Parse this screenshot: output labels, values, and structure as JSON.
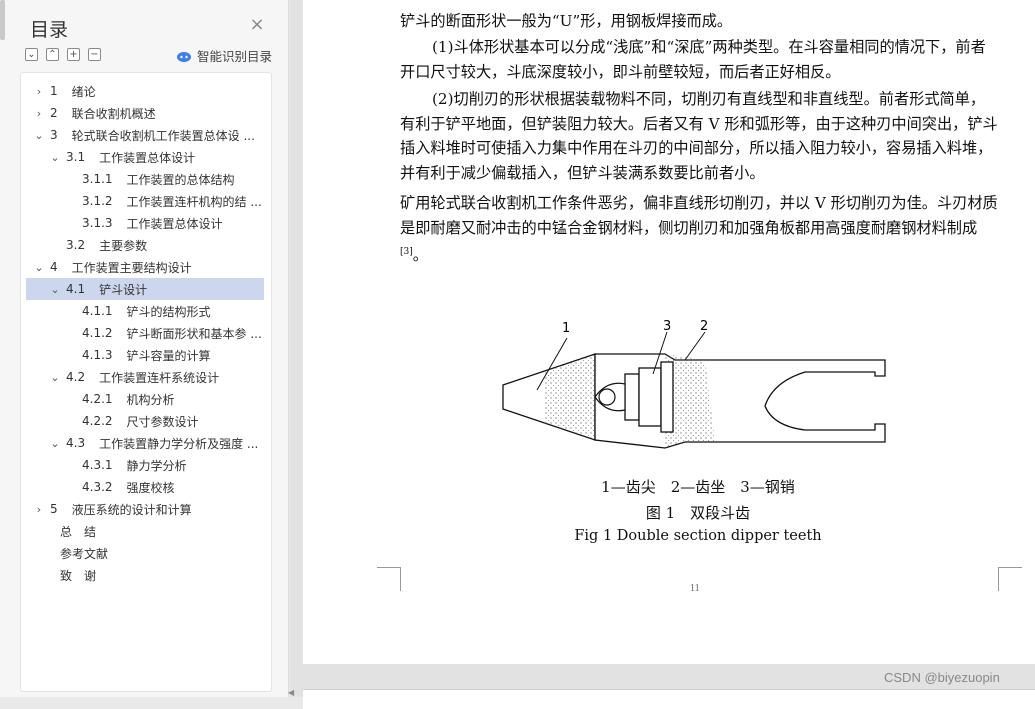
{
  "sidebar": {
    "title": "目录",
    "smart_label": "智能识别目录",
    "toc": [
      {
        "num": "1",
        "text": "绪论",
        "level": 1,
        "toggle": ">",
        "selected": false
      },
      {
        "num": "2",
        "text": "联合收割机概述",
        "level": 1,
        "toggle": ">",
        "selected": false
      },
      {
        "num": "3",
        "text": "轮式联合收割机工作装置总体设 ...",
        "level": 1,
        "toggle": "v",
        "selected": false
      },
      {
        "num": "3.1",
        "text": "工作装置总体设计",
        "level": 2,
        "toggle": "v",
        "selected": false
      },
      {
        "num": "3.1.1",
        "text": "工作装置的总体结构",
        "level": 3,
        "toggle": "",
        "selected": false
      },
      {
        "num": "3.1.2",
        "text": "工作装置连杆机构的结 ...",
        "level": 3,
        "toggle": "",
        "selected": false
      },
      {
        "num": "3.1.3",
        "text": "工作装置总体设计",
        "level": 3,
        "toggle": "",
        "selected": false
      },
      {
        "num": "3.2",
        "text": "主要参数",
        "level": 2,
        "toggle": "",
        "selected": false
      },
      {
        "num": "4",
        "text": "工作装置主要结构设计",
        "level": 1,
        "toggle": "v",
        "selected": false
      },
      {
        "num": "4.1",
        "text": "铲斗设计",
        "level": 2,
        "toggle": "v",
        "selected": true
      },
      {
        "num": "4.1.1",
        "text": "铲斗的结构形式",
        "level": 3,
        "toggle": "",
        "selected": false
      },
      {
        "num": "4.1.2",
        "text": "铲斗断面形状和基本参 ...",
        "level": 3,
        "toggle": "",
        "selected": false
      },
      {
        "num": "4.1.3",
        "text": "铲斗容量的计算",
        "level": 3,
        "toggle": "",
        "selected": false
      },
      {
        "num": "4.2",
        "text": "工作装置连杆系统设计",
        "level": 2,
        "toggle": "v",
        "selected": false
      },
      {
        "num": "4.2.1",
        "text": "机构分析",
        "level": 3,
        "toggle": "",
        "selected": false
      },
      {
        "num": "4.2.2",
        "text": "尺寸参数设计",
        "level": 3,
        "toggle": "",
        "selected": false
      },
      {
        "num": "4.3",
        "text": "工作装置静力学分析及强度 ...",
        "level": 2,
        "toggle": "v",
        "selected": false
      },
      {
        "num": "4.3.1",
        "text": "静力学分析",
        "level": 3,
        "toggle": "",
        "selected": false
      },
      {
        "num": "4.3.2",
        "text": "强度校核",
        "level": 3,
        "toggle": "",
        "selected": false
      },
      {
        "num": "5",
        "text": "液压系统的设计和计算",
        "level": 1,
        "toggle": ">",
        "selected": false
      },
      {
        "num": "",
        "text": "总　结",
        "level": 0,
        "toggle": "",
        "selected": false
      },
      {
        "num": "",
        "text": "参考文献",
        "level": 0,
        "toggle": "",
        "selected": false
      },
      {
        "num": "",
        "text": "致　谢",
        "level": 0,
        "toggle": "",
        "selected": false
      }
    ]
  },
  "document": {
    "p1": "铲斗的断面形状一般为“U”形，用钢板焊接而成。",
    "p2": "(1)斗体形状基本可以分成“浅底”和“深底”两种类型。在斗容量相同的情况下，前者开口尺寸较大，斗底深度较小，即斗前壁较短，而后者正好相反。",
    "p3": "(2)切削刃的形状根据装载物料不同，切削刃有直线型和非直线型。前者形式简单，有利于铲平地面，但铲装阻力较大。后者又有 V 形和弧形等，由于这种刃中间突出，铲斗插入料堆时可使插入力集中作用在斗刃的中间部分，所以插入阻力较小，容易插入料堆，并有利于减少偏载插入，但铲斗装满系数要比前者小。",
    "p4": "矿用轮式联合收割机工作条件恶劣，偏非直线形切削刃，并以 V 形切削刃为佳。斗刃材质是即耐磨又耐冲击的中锰合金钢材料，侧切削刃和加强角板都用高强度耐磨钢材料制成",
    "p4_ref": "[3]",
    "p4_end": "。",
    "fig_labels": [
      "1",
      "3",
      "2"
    ],
    "legend": "1—齿尖　2—齿坐　3—钢销",
    "caption_cn": "图 1　双段斗齿",
    "caption_en": "Fig 1 Double section dipper teeth",
    "page_number": "11"
  },
  "watermark": "CSDN @biyezuopin"
}
